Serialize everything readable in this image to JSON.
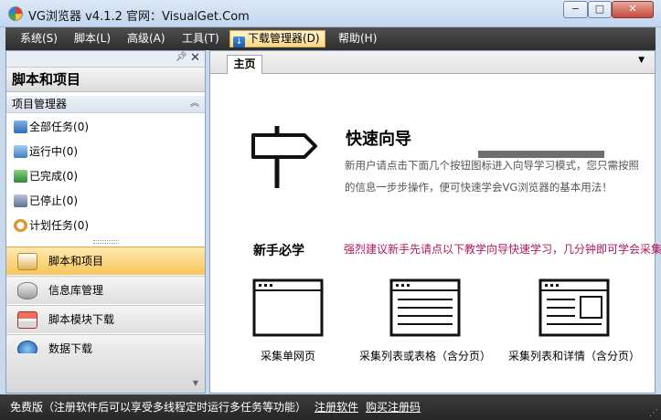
{
  "window": {
    "title": "VG浏览器 v4.1.2 官网：VisualGet.Com",
    "minimize": "−",
    "maximize": "□",
    "close": "✕"
  },
  "menu": {
    "items": [
      {
        "label": "系统(S)"
      },
      {
        "label": "脚本(L)"
      },
      {
        "label": "高级(A)"
      },
      {
        "label": "工具(T)"
      },
      {
        "label": "下载管理器(D)"
      },
      {
        "label": "帮助(H)"
      }
    ],
    "active_index": 4
  },
  "left_panel": {
    "title": "脚本和项目",
    "section": "项目管理器",
    "tree": [
      {
        "label": "全部任务",
        "count": "(0)",
        "icon": "computer-icon"
      },
      {
        "label": "运行中",
        "count": "(0)",
        "icon": "running-icon"
      },
      {
        "label": "已完成",
        "count": "(0)",
        "icon": "completed-icon"
      },
      {
        "label": "已停止",
        "count": "(0)",
        "icon": "stopped-icon"
      },
      {
        "label": "计划任务",
        "count": "(0)",
        "icon": "clock-icon"
      }
    ],
    "nav": [
      {
        "label": "脚本和项目",
        "icon": "script-icon"
      },
      {
        "label": "信息库管理",
        "icon": "database-icon"
      },
      {
        "label": "脚本模块下载",
        "icon": "store-icon"
      },
      {
        "label": "数据下载",
        "icon": "download-icon"
      }
    ],
    "active_nav_index": 0
  },
  "main": {
    "tab": "主页",
    "quick_start": {
      "title": "快速向导",
      "line1": "新用户请点击下面几个按钮图标进入向导学习模式，您只需按照",
      "line2": "的信息一步步操作，便可快速学会VG浏览器的基本用法！"
    },
    "newbie": {
      "title": "新手必学",
      "text": "强烈建议新手先请点以下教学向导快速学习，几分钟即可学会采集"
    },
    "guides": [
      {
        "label": "采集单网页"
      },
      {
        "label": "采集列表或表格（含分页）"
      },
      {
        "label": "采集列表和详情（含分页）"
      }
    ]
  },
  "status": {
    "text": "免费版（注册软件后可以享受多线程定时运行多任务等功能）",
    "register": "注册软件",
    "buy": "购买注册码"
  },
  "colors": {
    "menubar": "#3a3a3a",
    "active_accent": "#f8c45a",
    "newbie_text": "#b0175c"
  }
}
